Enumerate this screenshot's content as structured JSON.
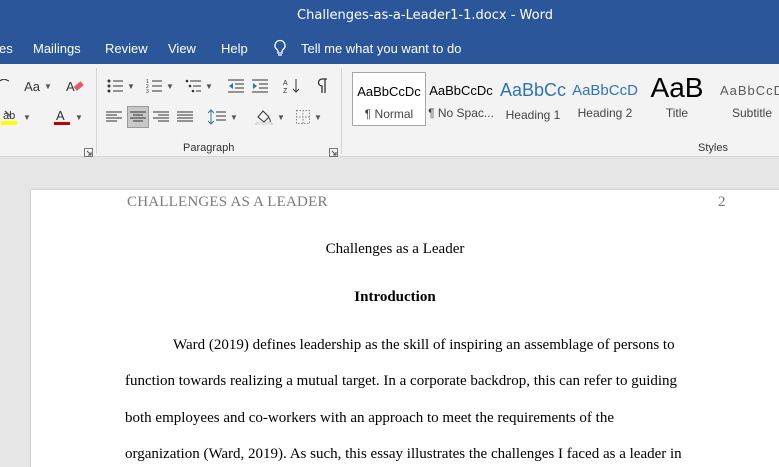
{
  "window": {
    "title": "Challenges-as-a-Leader1-1.docx  -  Word"
  },
  "menu": {
    "tabs": [
      "es",
      "Mailings",
      "Review",
      "View",
      "Help"
    ],
    "tell_me": "Tell me what you want to do"
  },
  "ribbon": {
    "font_group": {
      "change_case_label": "Aa"
    },
    "paragraph_group": {
      "label": "Paragraph"
    },
    "styles_group": {
      "label": "Styles",
      "items": [
        {
          "sample": "AaBbCcDc",
          "name": "¶ Normal",
          "selected": true
        },
        {
          "sample": "AaBbCcDc",
          "name": "¶ No Spac..."
        },
        {
          "sample": "AaBbCc",
          "name": "Heading 1"
        },
        {
          "sample": "AaBbCcD",
          "name": "Heading 2"
        },
        {
          "sample": "AaB",
          "name": "Title"
        },
        {
          "sample": "AaBbCcD",
          "name": "Subtitle"
        }
      ]
    },
    "colors": {
      "highlight": "#ffff00",
      "font_color": "#c00000",
      "heading_blue": "#2e74b5"
    }
  },
  "document": {
    "running_head": "CHALLENGES AS A LEADER",
    "page_number": "2",
    "title": "Challenges as a Leader",
    "heading": "Introduction",
    "lines": [
      "Ward (2019) defines leadership as the skill of inspiring an assemblage of persons to",
      "function towards realizing a mutual target. In a corporate backdrop, this can refer to guiding",
      "both employees and co-workers with an approach to meet the requirements of the",
      "organization (Ward, 2019). As such, this essay illustrates the challenges I faced as a leader in"
    ]
  }
}
